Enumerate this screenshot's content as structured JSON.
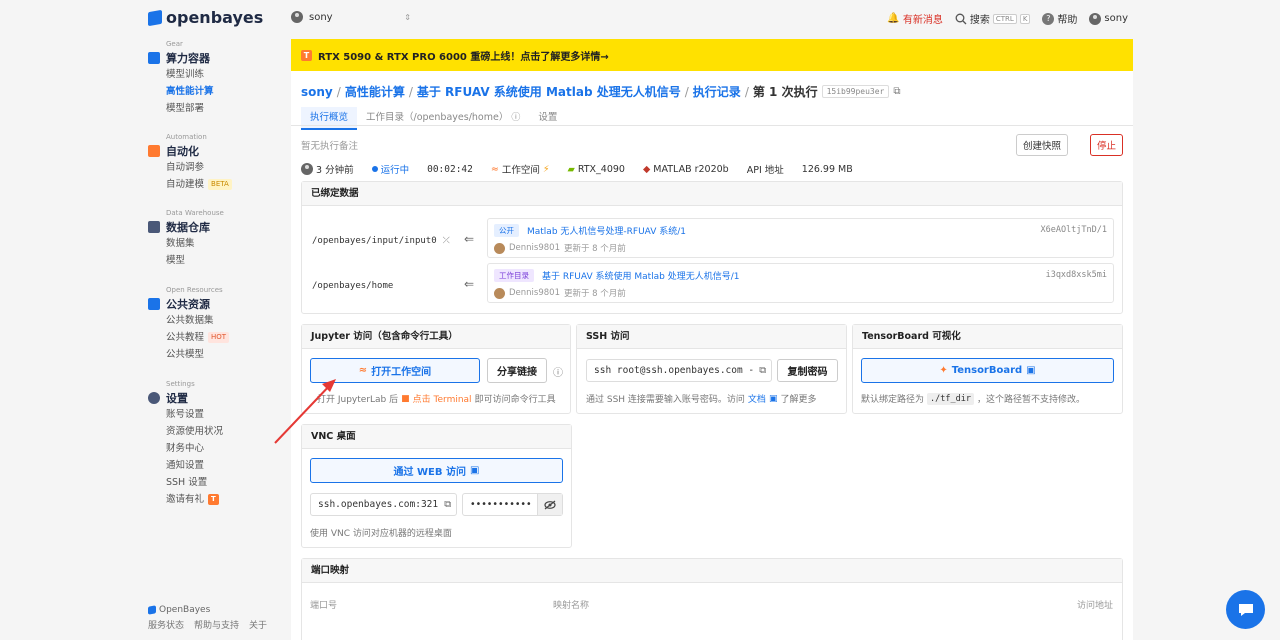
{
  "brand": {
    "name": "openbayes"
  },
  "user": {
    "name": "sony"
  },
  "sidebar": {
    "sections": [
      {
        "eyebrow": "Gear",
        "title": "算力容器",
        "items": [
          {
            "label": "模型训练",
            "active": false
          },
          {
            "label": "高性能计算",
            "active": true
          },
          {
            "label": "模型部署",
            "active": false
          }
        ]
      },
      {
        "eyebrow": "Automation",
        "title": "自动化",
        "items": [
          {
            "label": "自动调参"
          },
          {
            "label": "自动建模",
            "tag": "BETA"
          }
        ]
      },
      {
        "eyebrow": "Data Warehouse",
        "title": "数据仓库",
        "items": [
          {
            "label": "数据集"
          },
          {
            "label": "模型"
          }
        ]
      },
      {
        "eyebrow": "Open Resources",
        "title": "公共资源",
        "items": [
          {
            "label": "公共数据集"
          },
          {
            "label": "公共教程",
            "tag": "HOT"
          },
          {
            "label": "公共模型"
          }
        ]
      },
      {
        "eyebrow": "Settings",
        "title": "设置",
        "items": [
          {
            "label": "账号设置"
          },
          {
            "label": "资源使用状况"
          },
          {
            "label": "财务中心"
          },
          {
            "label": "通知设置"
          },
          {
            "label": "SSH 设置"
          },
          {
            "label": "邀请有礼",
            "tag": "T"
          }
        ]
      }
    ],
    "footer": {
      "brand": "OpenBayes",
      "links": [
        "服务状态",
        "帮助与支持",
        "关于"
      ]
    }
  },
  "topbar": {
    "notice": "有新消息",
    "search": "搜索",
    "kbd1": "CTRL",
    "kbd2": "K",
    "help": "帮助",
    "user": "sony"
  },
  "banner": {
    "badge": "T",
    "text": "RTX 5090 & RTX PRO 6000 重磅上线！点击了解更多详情→"
  },
  "breadcrumb": {
    "items": [
      "sony",
      "高性能计算",
      "基于 RFUAV 系统使用 Matlab 处理无人机信号",
      "执行记录"
    ],
    "current": "第 1 次执行",
    "run_id": "15ib99peu3er"
  },
  "tabs": [
    {
      "label": "执行概览",
      "active": true
    },
    {
      "label": "工作目录（/openbayes/home）",
      "active": false
    },
    {
      "label": "设置",
      "active": false
    }
  ],
  "note": "暂无执行备注",
  "actions": {
    "snapshot": "创建快照",
    "stop": "停止"
  },
  "status": {
    "time_ago": "3 分钟前",
    "state": "运行中",
    "duration": "00:02:42",
    "workspace": "工作空间",
    "gpu": "RTX_4090",
    "image": "MATLAB r2020b",
    "api": "API 地址",
    "memory": "126.99 MB"
  },
  "bound_data": {
    "title": "已绑定数据",
    "rows": [
      {
        "path": "/openbayes/input/input0",
        "tag": "公开",
        "name": "Matlab 无人机信号处理-RFUAV 系统/1",
        "author": "Dennis9801",
        "updated": "更新于 8 个月前",
        "id": "X6eAOltjTnD/1"
      },
      {
        "path": "/openbayes/home",
        "tag": "工作目录",
        "name": "基于 RFUAV 系统使用 Matlab 处理无人机信号/1",
        "author": "Dennis9801",
        "updated": "更新于 8 个月前",
        "id": "i3qxd8xsk5mi"
      }
    ]
  },
  "jupyter": {
    "title": "Jupyter 访问（包含命令行工具）",
    "open_btn": "打开工作空间",
    "share_btn": "分享链接",
    "hint_pre": "打开 JupyterLab 后",
    "hint_link": "点击 Terminal",
    "hint_post": "即可访问命令行工具"
  },
  "ssh": {
    "title": "SSH 访问",
    "command": "ssh root@ssh.openbayes.com -",
    "copy_pwd": "复制密码",
    "hint_pre": "通过 SSH 连接需要输入账号密码。访问",
    "hint_link": "文档",
    "hint_post": "了解更多"
  },
  "tensorboard": {
    "title": "TensorBoard 可视化",
    "btn": "TensorBoard",
    "hint_pre": "默认绑定路径为",
    "path": "./tf_dir",
    "hint_post": "，这个路径暂不支持修改。"
  },
  "vnc": {
    "title": "VNC 桌面",
    "web_btn": "通过 WEB 访问",
    "address": "ssh.openbayes.com:321",
    "password": "•••••••••••",
    "hint": "使用 VNC 访问对应机器的远程桌面"
  },
  "ports": {
    "title": "端口映射",
    "columns": [
      "端口号",
      "映射名称",
      "访问地址"
    ]
  },
  "colors": {
    "accent": "#1a73e8",
    "banner": "#ffe100",
    "danger": "#d93025",
    "annotation": "#e53935"
  }
}
